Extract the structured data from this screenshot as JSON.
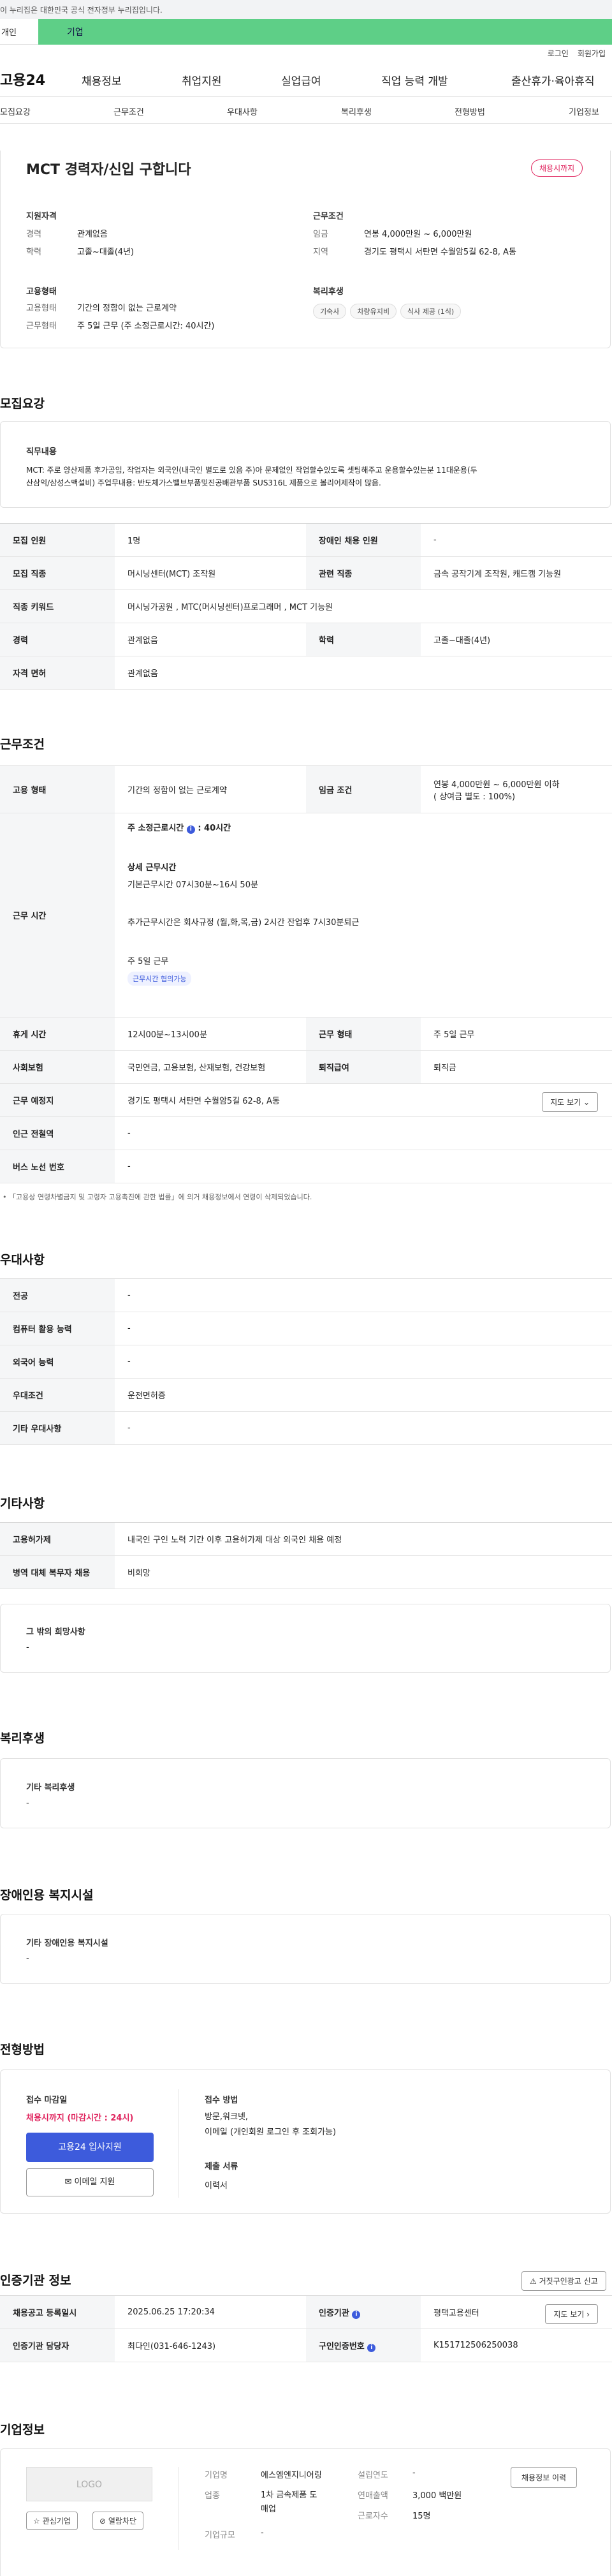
{
  "gov_banner": "이 누리집은 대한민국 공식 전자정부 누리집입니다.",
  "top_tabs": {
    "personal": "개인",
    "company": "기업"
  },
  "util": {
    "login": "로그인",
    "signup": "회원가입"
  },
  "gnb": {
    "logo": "고용24",
    "items": [
      "채용정보",
      "취업지원",
      "실업급여",
      "직업 능력 개발",
      "출산휴가·육아휴직"
    ]
  },
  "anchor_nav": [
    "모집요강",
    "근무조건",
    "우대사항",
    "복리후생",
    "전형방법",
    "기업정보"
  ],
  "summary": {
    "title": "MCT 경력자/신입 구합니다",
    "status_badge": "채용시까지",
    "qual_head": "지원자격",
    "qual": [
      {
        "k": "경력",
        "v": "관계없음"
      },
      {
        "k": "학력",
        "v": "고졸~대졸(4년)"
      }
    ],
    "cond_head": "근무조건",
    "cond": [
      {
        "k": "임금",
        "v": "연봉 4,000만원 ~ 6,000만원"
      },
      {
        "k": "지역",
        "v": "경기도 평택시 서탄면 수월암5길 62-8, A동"
      }
    ],
    "emp_head": "고용형태",
    "emp": [
      {
        "k": "고용형태",
        "v": "기간의 정함이 없는 근로계약"
      },
      {
        "k": "근무형태",
        "v": "주 5일 근무 (주 소정근로시간: 40시간)"
      }
    ],
    "welfare_head": "복리후생",
    "welfare_chips": [
      "기숙사",
      "차량유지비",
      "식사 제공 (1식)"
    ]
  },
  "recruit": {
    "heading": "모집요강",
    "job_desc_head": "직무내용",
    "job_desc_1": "MCT: 주로 양산제품 후가공임, 작업자는 외국인(내국인 별도로 있음 주)아 문제없인 작업할수있도록 셋팅해주고 운용할수있는분 11대운용(두",
    "job_desc_2": "산삼익/삼성스맥설비)     주업무내용: 반도체가스밸브부품및진공배관부품   SUS316L 제품으로 볼리어제작이 많음.",
    "rows": [
      {
        "k1": "모집 인원",
        "v1": "1명",
        "k2": "장애인 채용 인원",
        "v2": "-"
      },
      {
        "k1": "모집 직종",
        "v1": "머시닝센터(MCT) 조작원",
        "k2": "관련 직종",
        "v2": "금속 공작기계 조작원, 캐드캠 기능원"
      },
      {
        "k1": "직종 키워드",
        "v1": "머시닝가공원 , MTC(머시닝센터)프로그래머 , MCT 기능원",
        "k2": "",
        "v2": ""
      },
      {
        "k1": "경력",
        "v1": "관계없음",
        "k2": "학력",
        "v2": "고졸~대졸(4년)"
      },
      {
        "k1": "자격 면허",
        "v1": "관계없음",
        "k2": "",
        "v2": ""
      }
    ]
  },
  "work": {
    "heading": "근무조건",
    "emp_type_k": "고용 형태",
    "emp_type_v": "기간의 정함이 없는 근로계약",
    "wage_k": "임금 조건",
    "wage_v1": "연봉 4,000만원 ~ 6,000만원 이하",
    "wage_v2": "( 상여금 별도 : 100%)",
    "hours_k": "근무 시간",
    "hours_std": "주 소정근로시간",
    "hours_std_val": ": 40시간",
    "hours_detail_head": "상세 근무시간",
    "hours_base": "기본근무시간  07시30분~16시 50분",
    "hours_extra": "추가근무시간은   회사규정 (월,화,목,금) 2시간 잔업후 7시30분퇴근",
    "week": "주 5일 근무",
    "week_chip": "근무시간 협의가능",
    "rows": [
      {
        "k1": "휴게 시간",
        "v1": "12시00분~13시00분",
        "k2": "근무 형태",
        "v2": "주 5일 근무"
      },
      {
        "k1": "사회보험",
        "v1": "국민연금, 고용보험, 산재보험, 건강보험",
        "k2": "퇴직급여",
        "v2": "퇴직금"
      }
    ],
    "place_k": "근무 예정지",
    "place_v": "경기도 평택시 서탄면 수월암5길 62-8, A동",
    "map_btn": "지도 보기",
    "station_k": "인근 전철역",
    "station_v": "-",
    "bus_k": "버스 노선 번호",
    "bus_v": "-",
    "note": "「고용상 연령차별금지 및 고령자 고용촉진에 관한 법률」에 의거 채용정보에서 연령이 삭제되었습니다."
  },
  "pref": {
    "heading": "우대사항",
    "rows": [
      {
        "k": "전공",
        "v": "-"
      },
      {
        "k": "컴퓨터 활용 능력",
        "v": "-"
      },
      {
        "k": "외국어 능력",
        "v": "-"
      },
      {
        "k": "우대조건",
        "v": "운전면허증"
      },
      {
        "k": "기타 우대사항",
        "v": "-"
      }
    ]
  },
  "etc": {
    "heading": "기타사항",
    "rows": [
      {
        "k": "고용허가제",
        "v": "내국인 구인 노력 기간 이후 고용허가제 대상 외국인 채용 예정"
      },
      {
        "k": "병역 대체 복무자 채용",
        "v": "비희망"
      }
    ],
    "other_head": "그 밖의 희망사항",
    "other_val": "-"
  },
  "welfare": {
    "heading": "복리후생",
    "box_head": "기타 복리후생",
    "box_val": "-"
  },
  "disability": {
    "heading": "장애인용 복지시설",
    "box_head": "기타 장애인용 복지시설",
    "box_val": "-"
  },
  "selection": {
    "heading": "전형방법",
    "deadline_head": "접수 마감일",
    "deadline_val": "채용시까지 (마감시간 : 24시)",
    "apply_btn": "고용24 입사지원",
    "email_btn": "이메일 지원",
    "method_head": "접수 방법",
    "method_1": "방문,워크넷,",
    "method_2": "이메일 (개인회원 로그인 후 조회가능)",
    "docs_head": "제출 서류",
    "docs_val": "이력서"
  },
  "agency": {
    "heading": "인증기관 정보",
    "report_btn": "거짓구인광고 신고",
    "rows": [
      {
        "k1": "채용공고 등록일시",
        "v1": "2025.06.25 17:20:34",
        "k2": "인증기관",
        "v2": "평택고용센터",
        "btn": "지도 보기"
      },
      {
        "k1": "인증기관 담당자",
        "v1": "최다인(031-646-1243)",
        "k2": "구인인증번호",
        "v2": "K151712506250038",
        "btn": ""
      }
    ]
  },
  "company": {
    "heading": "기업정보",
    "logo_text": "LOGO",
    "interest_btn": "관심기업",
    "block_btn": "열람차단",
    "name_k": "기업명",
    "name_v": "에스엠엔지니어링",
    "est_k": "설립연도",
    "est_v": "-",
    "biz_k": "업종",
    "biz_v1": "1차 금속제품 도",
    "biz_v2": "매업",
    "sales_k": "연매출액",
    "sales_v": "3,000 백만원",
    "size_k": "기업규모",
    "size_v": "-",
    "staff_k": "근로자수",
    "staff_v": "15명",
    "history_btn": "채용정보 이력"
  },
  "colors": {
    "accent_green": "#5ecf87",
    "accent_blue": "#3d5bdc",
    "accent_red": "#e0245e"
  }
}
